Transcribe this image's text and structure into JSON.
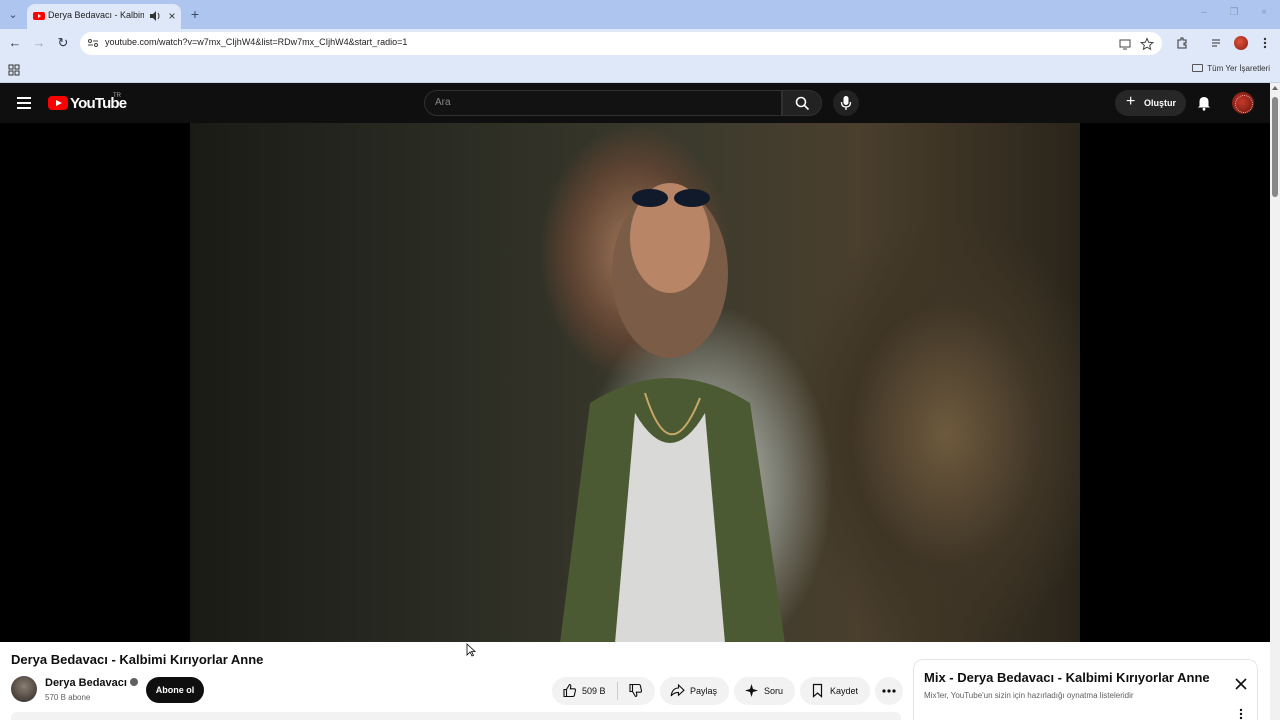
{
  "browser": {
    "tab": {
      "title": "Derya Bedavacı - Kalbimi K"
    },
    "url": "youtube.com/watch?v=w7mx_CIjhW4&list=RDw7mx_CIjhW4&start_radio=1",
    "bookmarks": {
      "all_label": "Tüm Yer İşaretleri"
    },
    "colors": {
      "tabstrip": "#aec5ef",
      "toolbar": "#dfe8f8"
    }
  },
  "youtube": {
    "logo_text": "YouTube",
    "country": "TR",
    "search": {
      "placeholder": "Ara"
    },
    "create_label": "Oluştur",
    "colors": {
      "header": "#0f0f0f",
      "brand": "#ff0000"
    }
  },
  "video": {
    "title": "Derya Bedavacı - Kalbimi Kırıyorlar Anne",
    "channel": {
      "name": "Derya Bedavacı",
      "subscribers": "570 B abone"
    },
    "subscribe_label": "Abone ol",
    "actions": {
      "likes": "509 B",
      "share": "Paylaş",
      "ask": "Soru",
      "save": "Kaydet"
    }
  },
  "mix": {
    "title": "Mix - Derya Bedavacı - Kalbimi Kırıyorlar Anne",
    "description": "Mix'ler, YouTube'un sizin için hazırladığı oynatma listeleridir"
  }
}
